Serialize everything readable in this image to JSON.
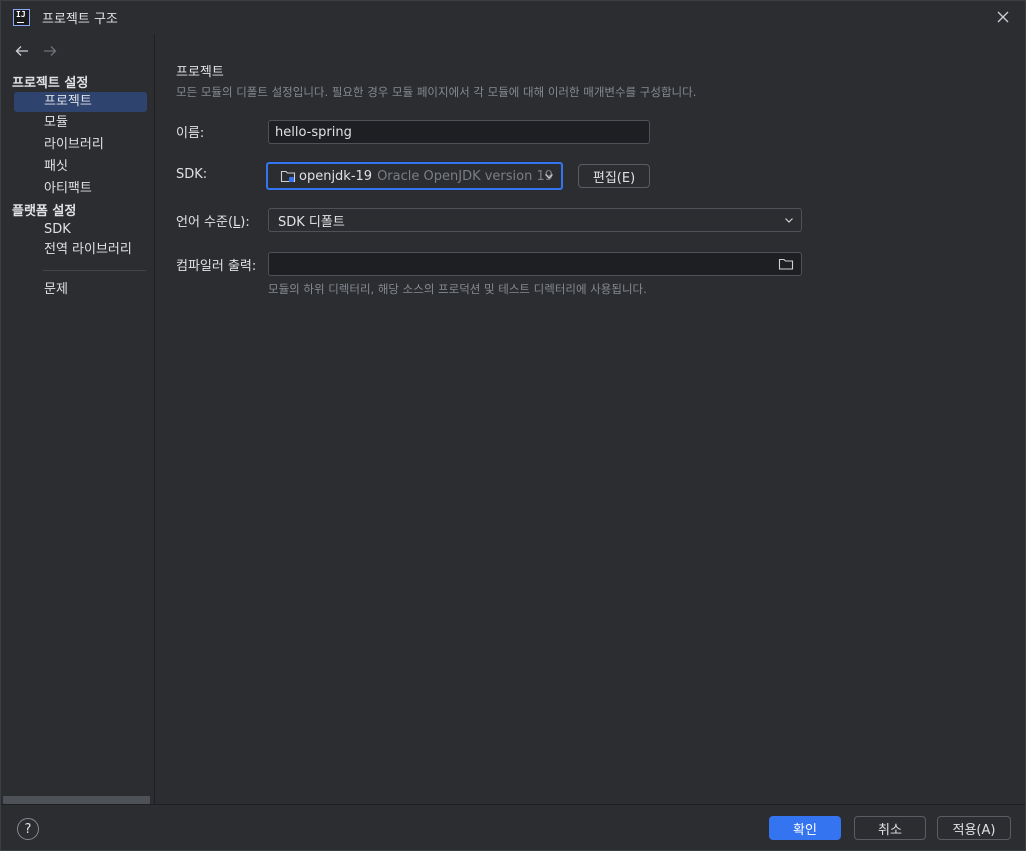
{
  "window": {
    "title": "프로젝트 구조",
    "app_icon_text": "IJ"
  },
  "sidebar": {
    "project_settings_header": "프로젝트 설정",
    "project_items": [
      {
        "label": "프로젝트",
        "selected": true
      },
      {
        "label": "모듈",
        "selected": false
      },
      {
        "label": "라이브러리",
        "selected": false
      },
      {
        "label": "패싯",
        "selected": false
      },
      {
        "label": "아티팩트",
        "selected": false
      }
    ],
    "platform_settings_header": "플랫폼 설정",
    "platform_items": [
      {
        "label": "SDK"
      },
      {
        "label": "전역 라이브러리"
      }
    ],
    "problems_item": "문제"
  },
  "main": {
    "title": "프로젝트",
    "description": "모든 모듈의 디폴트 설정입니다. 필요한 경우 모듈 페이지에서 각 모듈에 대해 이러한 매개변수를 구성합니다.",
    "name": {
      "label": "이름:",
      "value": "hello-spring"
    },
    "sdk": {
      "label": "SDK:",
      "value_name": "openjdk-19",
      "value_detail": "Oracle OpenJDK version 19",
      "edit_button": "편집(E)"
    },
    "language_level": {
      "label_prefix": "언어 수준(",
      "label_mnemonic": "L",
      "label_suffix": "):",
      "value": "SDK 디폴트"
    },
    "compiler_output": {
      "label": "컴파일러 출력:",
      "value": "",
      "hint": "모듈의 하위 디렉터리, 해당 소스의 프로덕션 및 테스트 디렉터리에 사용됩니다."
    }
  },
  "footer": {
    "help": "?",
    "ok": "확인",
    "cancel": "취소",
    "apply": "적용(A)"
  },
  "colors": {
    "background": "#2b2d30",
    "accent": "#3574f0",
    "selection": "#2e436e",
    "text": "#dfe1e5",
    "muted_text": "#868a91"
  }
}
